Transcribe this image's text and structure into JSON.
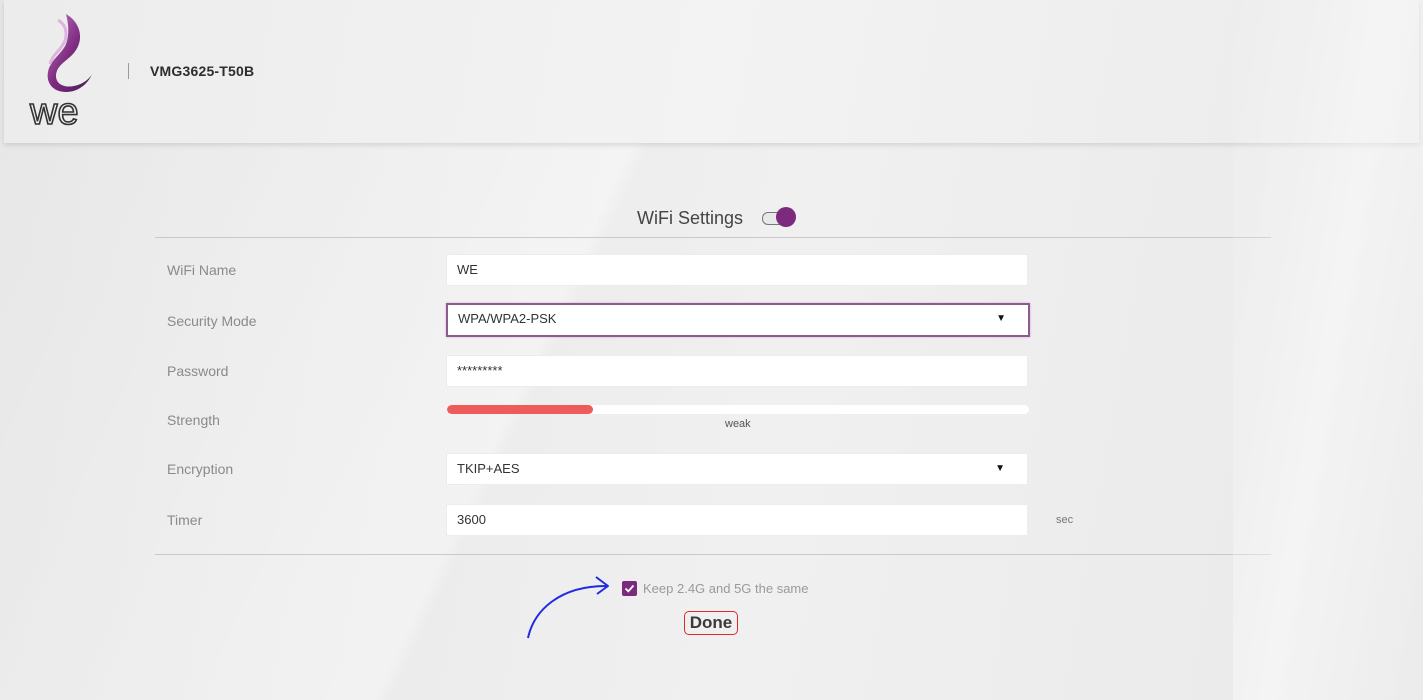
{
  "header": {
    "logo_text": "we",
    "model": "VMG3625-T50B"
  },
  "wifi": {
    "title": "WiFi Settings",
    "enabled": true,
    "fields": {
      "name": {
        "label": "WiFi Name",
        "value": "WE"
      },
      "security": {
        "label": "Security Mode",
        "value": "WPA/WPA2-PSK"
      },
      "password": {
        "label": "Password",
        "value": "*********"
      },
      "strength": {
        "label": "Strength",
        "level_percent": 25,
        "text": "weak"
      },
      "encryption": {
        "label": "Encryption",
        "value": "TKIP+AES"
      },
      "timer": {
        "label": "Timer",
        "value": "3600",
        "unit": "sec"
      }
    },
    "keep_same": {
      "checked": true,
      "label": "Keep 2.4G and 5G the same"
    },
    "done_label": "Done"
  },
  "colors": {
    "brand_purple": "#7b2a7d",
    "strength_weak": "#ee5b5b",
    "annotation_red": "#e12a2a",
    "annotation_blue": "#1f2be0"
  },
  "icons": [
    "we-logo-icon",
    "toggle-switch",
    "chevron-down-icon",
    "checkmark-icon",
    "annotation-arrow-icon"
  ]
}
